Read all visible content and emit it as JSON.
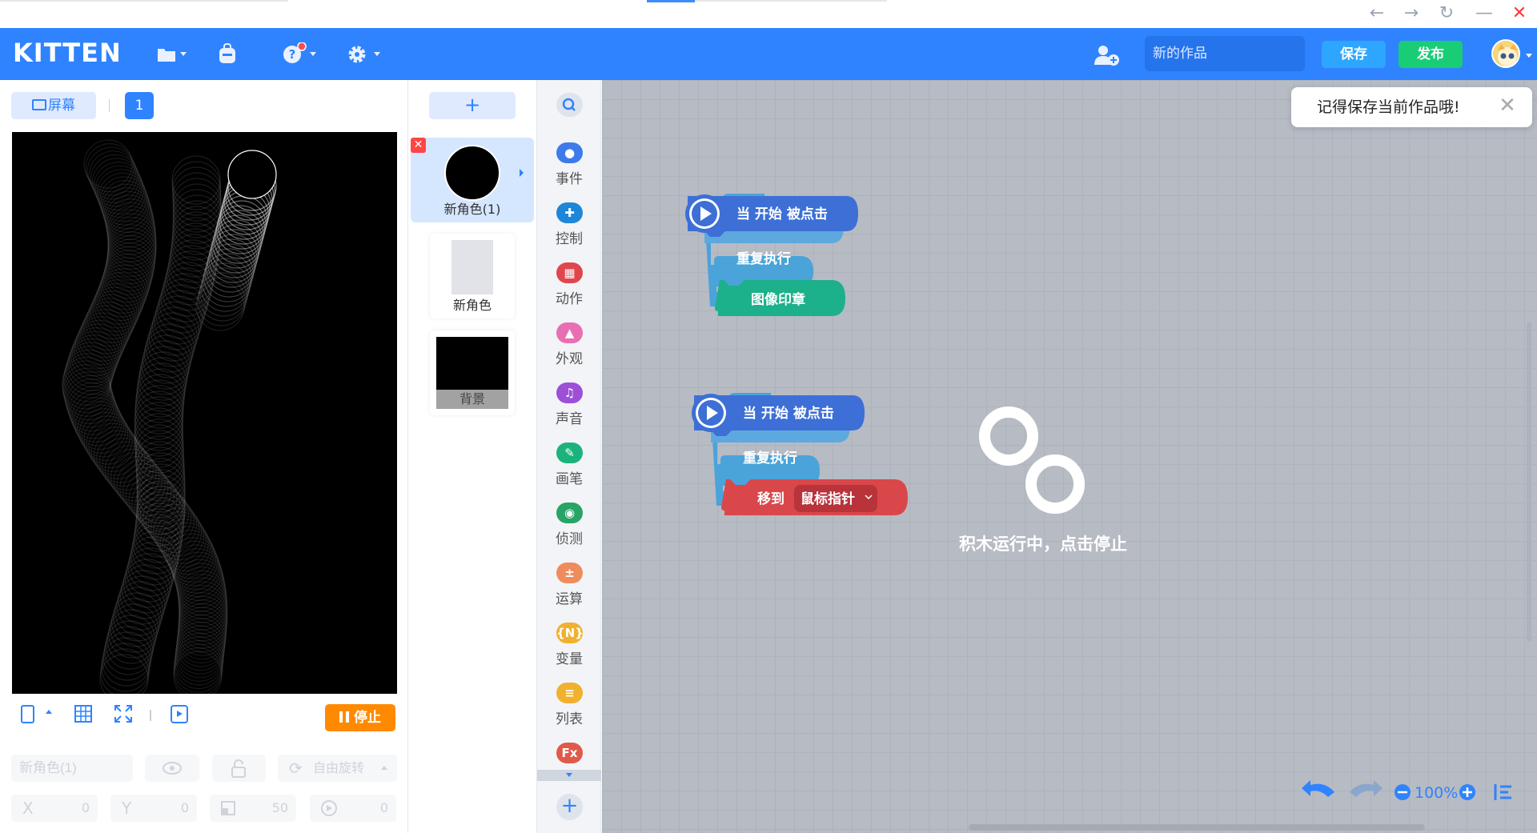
{
  "window": {
    "back_icon": "←",
    "forward_icon": "→",
    "refresh_icon": "↻",
    "minimize_icon": "—",
    "close_icon": "✕"
  },
  "header": {
    "logo": "KITTEN",
    "project_name_placeholder": "新的作品",
    "save_label": "保存",
    "publish_label": "发布"
  },
  "stage": {
    "screen_label": "屏幕",
    "page_number": "1",
    "stop_label": "停止",
    "sprite_name_placeholder": "新角色(1)",
    "rotation_label": "自由旋转",
    "x_label": "X",
    "x_value": "0",
    "y_label": "Y",
    "y_value": "0",
    "size_value": "50",
    "direction_value": "0"
  },
  "sprites": {
    "add_label": "+",
    "items": [
      {
        "label": "新角色(1)",
        "selected": true
      },
      {
        "label": "新角色",
        "selected": false
      },
      {
        "label": "背景",
        "selected": false
      }
    ]
  },
  "palette": {
    "categories": [
      {
        "label": "事件",
        "color": "#3d7bea"
      },
      {
        "label": "控制",
        "color": "#1e86d8"
      },
      {
        "label": "动作",
        "color": "#e0474c"
      },
      {
        "label": "外观",
        "color": "#e86fb2"
      },
      {
        "label": "声音",
        "color": "#9d4fd8"
      },
      {
        "label": "画笔",
        "color": "#1bb37b"
      },
      {
        "label": "侦测",
        "color": "#26a566"
      },
      {
        "label": "运算",
        "color": "#ef8c5d"
      },
      {
        "label": "变量",
        "color": "#f0b12e"
      },
      {
        "label": "列表",
        "color": "#f0b12e"
      },
      {
        "label": "Fx",
        "color": "#e05a4a"
      }
    ]
  },
  "workspace": {
    "script1": {
      "hat": "当 开始 被点击",
      "loop": "重复执行",
      "stamp": "图像印章"
    },
    "script2": {
      "hat": "当 开始 被点击",
      "loop": "重复执行",
      "move": "移到",
      "target": "鼠标指针"
    },
    "toast": "记得保存当前作品哦!",
    "running_text": "积木运行中，点击停止",
    "zoom": "100%"
  },
  "colors": {
    "accent": "#2f83ff",
    "save": "#2ea6ff",
    "publish": "#19cd77",
    "stop": "#ff8a00"
  }
}
